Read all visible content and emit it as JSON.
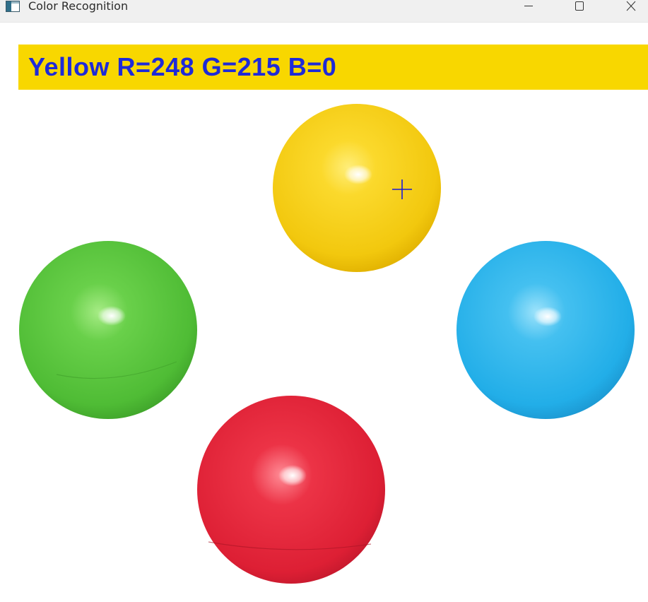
{
  "window": {
    "title": "Color Recognition",
    "controls": {
      "minimize_icon": "minimize-icon",
      "maximize_icon": "maximize-icon",
      "close_icon": "close-icon"
    }
  },
  "detection": {
    "label": "Yellow R=248 G=215 B=0",
    "color_name": "Yellow",
    "r": 248,
    "g": 215,
    "b": 0,
    "bar_color": "#f8d700",
    "text_color": "#1e2ad8"
  },
  "balls": [
    {
      "name": "yellow-ball",
      "color": "#f8d41a"
    },
    {
      "name": "green-ball",
      "color": "#5cc640"
    },
    {
      "name": "blue-ball",
      "color": "#34b8ee"
    },
    {
      "name": "red-ball",
      "color": "#e52238"
    }
  ],
  "cursor": {
    "icon": "crosshair-icon",
    "color": "#1a1ad8"
  }
}
